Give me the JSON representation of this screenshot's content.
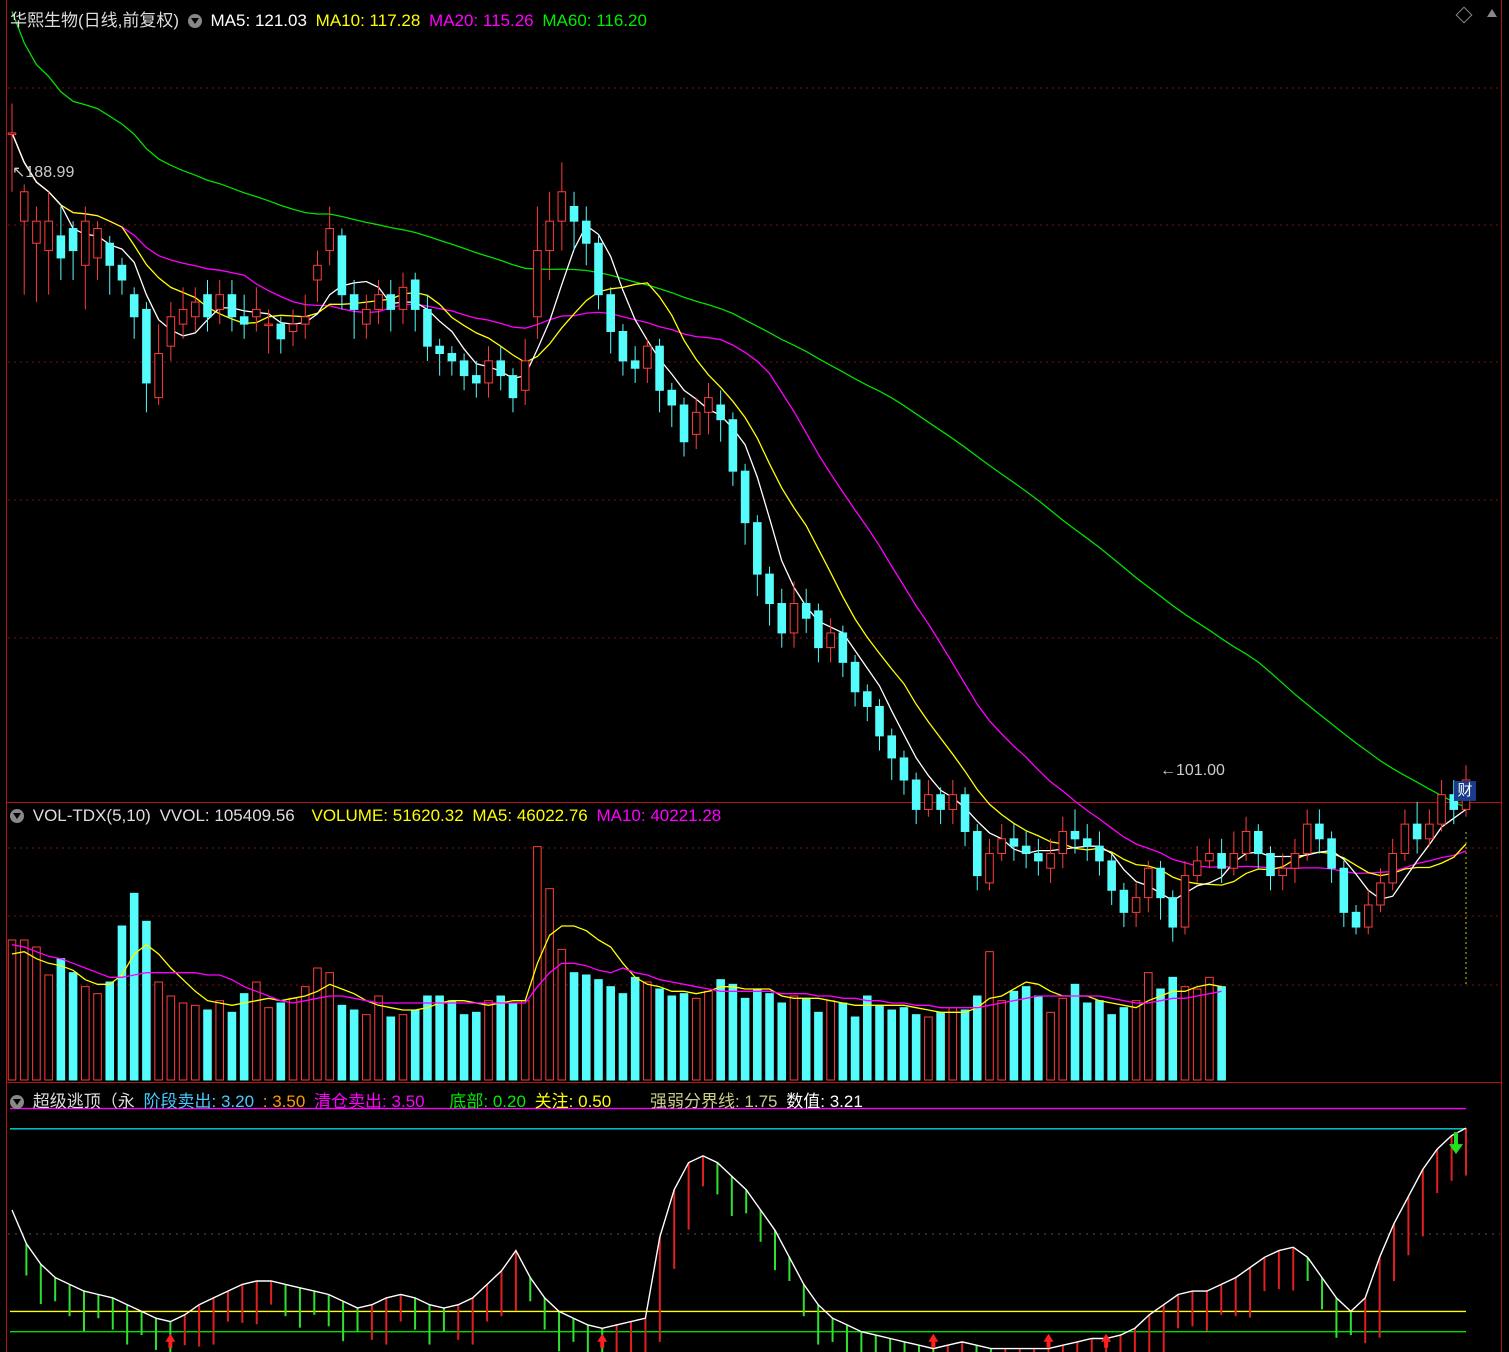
{
  "header_price": {
    "stock": "华熙生物(日线,前复权)",
    "ma5_label": "MA5:",
    "ma5": "121.03",
    "ma10_label": "MA10:",
    "ma10": "117.28",
    "ma20_label": "MA20:",
    "ma20": "115.26",
    "ma60_label": "MA60:",
    "ma60": "116.20"
  },
  "header_volume": {
    "name": "VOL-TDX(5,10)",
    "vvol_label": "VVOL:",
    "vvol": "105409.56",
    "volume_label": "VOLUME:",
    "volume": "51620.32",
    "ma5_label": "MA5:",
    "ma5": "46022.76",
    "ma10_label": "MA10:",
    "ma10": "40221.28"
  },
  "header_indicator": {
    "name": "超级逃顶（永",
    "stage_label": "阶段卖出:",
    "stage": "3.20",
    "stage2_label": ":",
    "stage2": "3.50",
    "clear_label": "清仓卖出:",
    "clear": "3.50",
    "bottom_label": "底部:",
    "bottom": "0.20",
    "watch_label": "关注:",
    "watch": "0.50",
    "divide_label": "强弱分界线:",
    "divide": "1.75",
    "value_label": "数值:",
    "value": "3.21"
  },
  "annotations": {
    "high": "188.99",
    "low": "101.00",
    "cai": "财"
  },
  "colors": {
    "up": "#ff3c3c",
    "down": "#54fcfc",
    "ma5": "#ffffff",
    "ma10": "#ffff00",
    "ma20": "#ff00ff",
    "ma60": "#00e000",
    "grid": "#7a1010"
  },
  "chart_data": [
    {
      "type": "candlestick",
      "title": "华熙生物(日线,前复权)",
      "ylim": [
        100,
        202
      ],
      "annotations": [
        {
          "text": "188.99",
          "x": 0
        },
        {
          "text": "101.00",
          "x": 96
        }
      ],
      "candles": [
        [
          188,
          188,
          192,
          180
        ],
        [
          176,
          180,
          181,
          166
        ],
        [
          173,
          176,
          178,
          165
        ],
        [
          172,
          176,
          180,
          166
        ],
        [
          174,
          171,
          178,
          168
        ],
        [
          175,
          172,
          176,
          168
        ],
        [
          170,
          176,
          178,
          164
        ],
        [
          171,
          175,
          176,
          168
        ],
        [
          173,
          170,
          174,
          166
        ],
        [
          170,
          168,
          171,
          166
        ],
        [
          166,
          163,
          167,
          160
        ],
        [
          164,
          154,
          165,
          150
        ],
        [
          152,
          158,
          162,
          151
        ],
        [
          159,
          163,
          165,
          157
        ],
        [
          162,
          164,
          167,
          160
        ],
        [
          163,
          165,
          167,
          161
        ],
        [
          166,
          163,
          168,
          161
        ],
        [
          164,
          166,
          168,
          162
        ],
        [
          166,
          163,
          168,
          161
        ],
        [
          163,
          162,
          166,
          160
        ],
        [
          163,
          164,
          167,
          161
        ],
        [
          162,
          162,
          164,
          158
        ],
        [
          162,
          160,
          163,
          158
        ],
        [
          161,
          162,
          164,
          159
        ],
        [
          162,
          163,
          166,
          160
        ],
        [
          168,
          170,
          172,
          165
        ],
        [
          172,
          175,
          178,
          170
        ],
        [
          174,
          166,
          175,
          164
        ],
        [
          166,
          164,
          168,
          160
        ],
        [
          162,
          164,
          166,
          160
        ],
        [
          164,
          166,
          168,
          162
        ],
        [
          166,
          164,
          168,
          161
        ],
        [
          164,
          167,
          169,
          162
        ],
        [
          168,
          164,
          169,
          161
        ],
        [
          164,
          159,
          166,
          157
        ],
        [
          159,
          158,
          160,
          155
        ],
        [
          158,
          157,
          159,
          155
        ],
        [
          157,
          155,
          158,
          153
        ],
        [
          155,
          154,
          157,
          152
        ],
        [
          154,
          157,
          159,
          152
        ],
        [
          157,
          155,
          159,
          153
        ],
        [
          155,
          152,
          156,
          150
        ],
        [
          153,
          157,
          160,
          151
        ],
        [
          163,
          172,
          178,
          160
        ],
        [
          172,
          176,
          180,
          168
        ],
        [
          176,
          180,
          184,
          172
        ],
        [
          178,
          176,
          180,
          172
        ],
        [
          176,
          173,
          178,
          170
        ],
        [
          173,
          166,
          174,
          164
        ],
        [
          166,
          161,
          167,
          158
        ],
        [
          161,
          157,
          162,
          155
        ],
        [
          157,
          156,
          159,
          154
        ],
        [
          156,
          159,
          160,
          154
        ],
        [
          159,
          153,
          160,
          150
        ],
        [
          153,
          151,
          154,
          148
        ],
        [
          151,
          146,
          152,
          144
        ],
        [
          147,
          150,
          152,
          145
        ],
        [
          150,
          152,
          154,
          147
        ],
        [
          151,
          149,
          153,
          146
        ],
        [
          149,
          142,
          150,
          140
        ],
        [
          142,
          135,
          143,
          132
        ],
        [
          135,
          128,
          136,
          125
        ],
        [
          128,
          124,
          129,
          121
        ],
        [
          124,
          120,
          126,
          118
        ],
        [
          120,
          124,
          127,
          118
        ],
        [
          124,
          122,
          126,
          120
        ],
        [
          123,
          118,
          124,
          116
        ],
        [
          118,
          120,
          122,
          116
        ],
        [
          120,
          116,
          121,
          114
        ],
        [
          116,
          112,
          117,
          110
        ],
        [
          112,
          110,
          113,
          108
        ],
        [
          110,
          106,
          111,
          104
        ],
        [
          106,
          103,
          107,
          100
        ],
        [
          103,
          100,
          104,
          98
        ],
        [
          100,
          96,
          101,
          94
        ],
        [
          96,
          98,
          100,
          95
        ],
        [
          98,
          96,
          99,
          94
        ],
        [
          96,
          98,
          100,
          94
        ],
        [
          98,
          93,
          99,
          91
        ],
        [
          93,
          87,
          94,
          85
        ],
        [
          86,
          90,
          92,
          85
        ],
        [
          90,
          92,
          94,
          89
        ],
        [
          92,
          91,
          94,
          89
        ],
        [
          91,
          90,
          93,
          88
        ],
        [
          90,
          89,
          92,
          87
        ],
        [
          88,
          90,
          92,
          86
        ],
        [
          90,
          93,
          95,
          88
        ],
        [
          93,
          92,
          96,
          90
        ],
        [
          92,
          91,
          94,
          89
        ],
        [
          91,
          89,
          93,
          87
        ],
        [
          89,
          85,
          90,
          83
        ],
        [
          85,
          82,
          86,
          80
        ],
        [
          82,
          84,
          86,
          80
        ],
        [
          84,
          88,
          89,
          82
        ],
        [
          88,
          84,
          89,
          81
        ],
        [
          84,
          80,
          85,
          78
        ],
        [
          80,
          87,
          89,
          79
        ],
        [
          87,
          89,
          91,
          86
        ],
        [
          89,
          90,
          92,
          88
        ],
        [
          90,
          88,
          92,
          86
        ],
        [
          88,
          90,
          93,
          87
        ],
        [
          90,
          93,
          95,
          89
        ],
        [
          93,
          90,
          94,
          88
        ],
        [
          90,
          87,
          91,
          85
        ],
        [
          87,
          88,
          90,
          85
        ],
        [
          88,
          90,
          92,
          86
        ],
        [
          90,
          94,
          96,
          89
        ],
        [
          94,
          92,
          96,
          90
        ],
        [
          92,
          88,
          93,
          86
        ],
        [
          88,
          82,
          89,
          80
        ],
        [
          82,
          80,
          83,
          79
        ],
        [
          80,
          83,
          85,
          79
        ],
        [
          83,
          86,
          88,
          82
        ],
        [
          86,
          90,
          92,
          85
        ],
        [
          90,
          94,
          96,
          89
        ],
        [
          94,
          92,
          97,
          90
        ],
        [
          92,
          94,
          96,
          91
        ],
        [
          94,
          98,
          100,
          93
        ],
        [
          98,
          96,
          100,
          94
        ],
        [
          96,
          100,
          102,
          95
        ]
      ]
    },
    {
      "type": "bar",
      "title": "VOL-TDX(5,10)",
      "series": [
        {
          "name": "VOLUME",
          "values": [
            60,
            60,
            57,
            45,
            52,
            46,
            40,
            37,
            42,
            66,
            80,
            68,
            42,
            36,
            33,
            32,
            30,
            34,
            29,
            37,
            42,
            31,
            33,
            35,
            40,
            48,
            46,
            32,
            30,
            28,
            36,
            27,
            28,
            30,
            36,
            36,
            34,
            28,
            29,
            34,
            36,
            33,
            34,
            100,
            82,
            56,
            46,
            45,
            43,
            40,
            37,
            44,
            42,
            39,
            36,
            37,
            35,
            38,
            43,
            41,
            35,
            39,
            37,
            33,
            36,
            35,
            29,
            34,
            33,
            27,
            36,
            32,
            30,
            31,
            28,
            27,
            29,
            31,
            30,
            36,
            55,
            34,
            38,
            40,
            36,
            29,
            35,
            41,
            33,
            34,
            28,
            31,
            34,
            46,
            39,
            44,
            40,
            39,
            44,
            40
          ]
        },
        {
          "name": "MA5",
          "values": [
            54,
            55,
            52,
            50,
            49,
            47,
            43,
            41,
            41,
            45,
            54,
            58,
            54,
            48,
            43,
            38,
            34,
            33,
            32,
            33,
            34,
            35,
            34,
            35,
            36,
            38,
            41,
            39,
            37,
            34,
            32,
            31,
            30,
            30,
            31,
            33,
            34,
            34,
            33,
            32,
            33,
            34,
            34,
            50,
            62,
            66,
            66,
            64,
            60,
            57,
            50,
            44,
            41,
            40,
            38,
            38,
            37,
            38,
            40,
            40,
            39,
            39,
            39,
            36,
            35,
            35,
            35,
            34,
            33,
            32,
            32,
            32,
            32,
            32,
            31,
            30,
            29,
            29,
            29,
            31,
            35,
            36,
            39,
            42,
            41,
            38,
            36,
            36,
            36,
            34,
            33,
            32,
            31,
            34,
            36,
            38,
            38,
            40,
            41,
            40
          ]
        },
        {
          "name": "MA10",
          "values": [
            58,
            57,
            55,
            53,
            52,
            50,
            48,
            46,
            44,
            44,
            45,
            46,
            46,
            46,
            46,
            46,
            45,
            45,
            43,
            40,
            38,
            36,
            34,
            33,
            34,
            35,
            36,
            36,
            35,
            34,
            33,
            33,
            33,
            33,
            33,
            33,
            33,
            33,
            33,
            33,
            33,
            33,
            33,
            40,
            46,
            50,
            50,
            49,
            47,
            46,
            48,
            46,
            45,
            43,
            42,
            41,
            40,
            39,
            38,
            38,
            38,
            38,
            38,
            37,
            37,
            37,
            36,
            36,
            35,
            35,
            34,
            34,
            33,
            33,
            32,
            32,
            31,
            31,
            31,
            31,
            32,
            33,
            34,
            35,
            36,
            36,
            36,
            36,
            36,
            36,
            35,
            34,
            33,
            33,
            34,
            35,
            35,
            36,
            37,
            38
          ]
        }
      ]
    },
    {
      "type": "line",
      "title": "超级逃顶（永",
      "ylim": [
        -0.1,
        3.7
      ],
      "reference_lines": [
        {
          "name": "阶段卖出",
          "value": 3.2
        },
        {
          "name": "清仓卖出",
          "value": 3.5
        },
        {
          "name": "底部",
          "value": 0.2
        },
        {
          "name": "关注",
          "value": 0.5
        }
      ],
      "series": [
        {
          "name": "数值",
          "values": [
            2.0,
            1.5,
            1.2,
            1.0,
            0.9,
            0.8,
            0.75,
            0.7,
            0.6,
            0.5,
            0.4,
            0.35,
            0.45,
            0.6,
            0.7,
            0.8,
            0.9,
            0.95,
            0.95,
            0.9,
            0.85,
            0.8,
            0.75,
            0.65,
            0.55,
            0.6,
            0.7,
            0.75,
            0.7,
            0.6,
            0.55,
            0.6,
            0.7,
            0.9,
            1.1,
            1.4,
            1.0,
            0.7,
            0.5,
            0.4,
            0.3,
            0.25,
            0.3,
            0.35,
            0.4,
            1.6,
            2.3,
            2.7,
            2.8,
            2.7,
            2.5,
            2.3,
            2.0,
            1.7,
            1.3,
            0.9,
            0.6,
            0.4,
            0.3,
            0.2,
            0.15,
            0.1,
            0.05,
            0.0,
            -0.05,
            0.0,
            0.05,
            0.0,
            -0.05,
            -0.05,
            -0.05,
            -0.05,
            -0.05,
            0.0,
            0.05,
            0.1,
            0.1,
            0.15,
            0.25,
            0.45,
            0.6,
            0.75,
            0.8,
            0.8,
            0.9,
            1.0,
            1.15,
            1.3,
            1.4,
            1.45,
            1.3,
            1.0,
            0.7,
            0.5,
            0.7,
            1.3,
            1.8,
            2.2,
            2.6,
            2.9,
            3.1,
            3.21
          ]
        }
      ]
    }
  ]
}
